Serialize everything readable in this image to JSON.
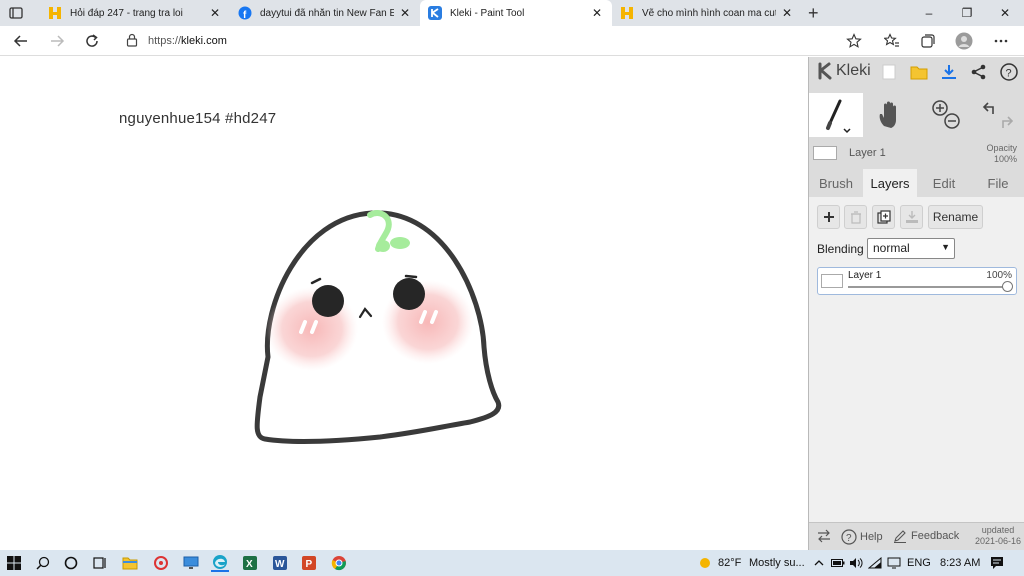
{
  "browser": {
    "tabs": [
      {
        "title": "Hỏi đáp 247 - trang tra loi",
        "icon": "hoidap-favicon"
      },
      {
        "title": "dayytui đã nhắn tin New Fan Ela",
        "icon": "facebook-favicon"
      },
      {
        "title": "Kleki - Paint Tool",
        "icon": "kleki-favicon",
        "active": true
      },
      {
        "title": "Vẽ cho mình hình coan ma cute",
        "icon": "hoidap-favicon"
      }
    ],
    "close_glyph": "✕",
    "new_tab_glyph": "+",
    "window_buttons": [
      "–",
      "❐",
      "✕"
    ],
    "address": {
      "prefix": "https://",
      "host": "kleki.com"
    }
  },
  "canvas": {
    "caption": "nguyenhue154  #hd247"
  },
  "kleki": {
    "logo": "Kleki",
    "layer_name": "Layer 1",
    "opacity_label": "Opacity",
    "opacity_value": "100%",
    "panel_tabs": [
      "Brush",
      "Layers",
      "Edit",
      "File"
    ],
    "active_tab": "Layers",
    "rename_label": "Rename",
    "blending_label": "Blending",
    "blending_value": "normal",
    "layers": [
      {
        "name": "Layer 1",
        "opacity": "100%",
        "opacity_fraction": 1.0
      }
    ],
    "footer": {
      "help": "Help",
      "feedback": "Feedback",
      "updated_label": "updated",
      "updated_date": "2021-06-16"
    }
  },
  "taskbar": {
    "weather_temp": "82°F",
    "weather_text": "Mostly su...",
    "language": "ENG",
    "time": "8:23 AM"
  },
  "colors": {
    "tab_bar": "#dfe3e8",
    "panel": "#dcdcdc",
    "accent_blue": "#1a73e8",
    "blush": "#f7b8b8",
    "sprout": "#a6ec9c"
  }
}
